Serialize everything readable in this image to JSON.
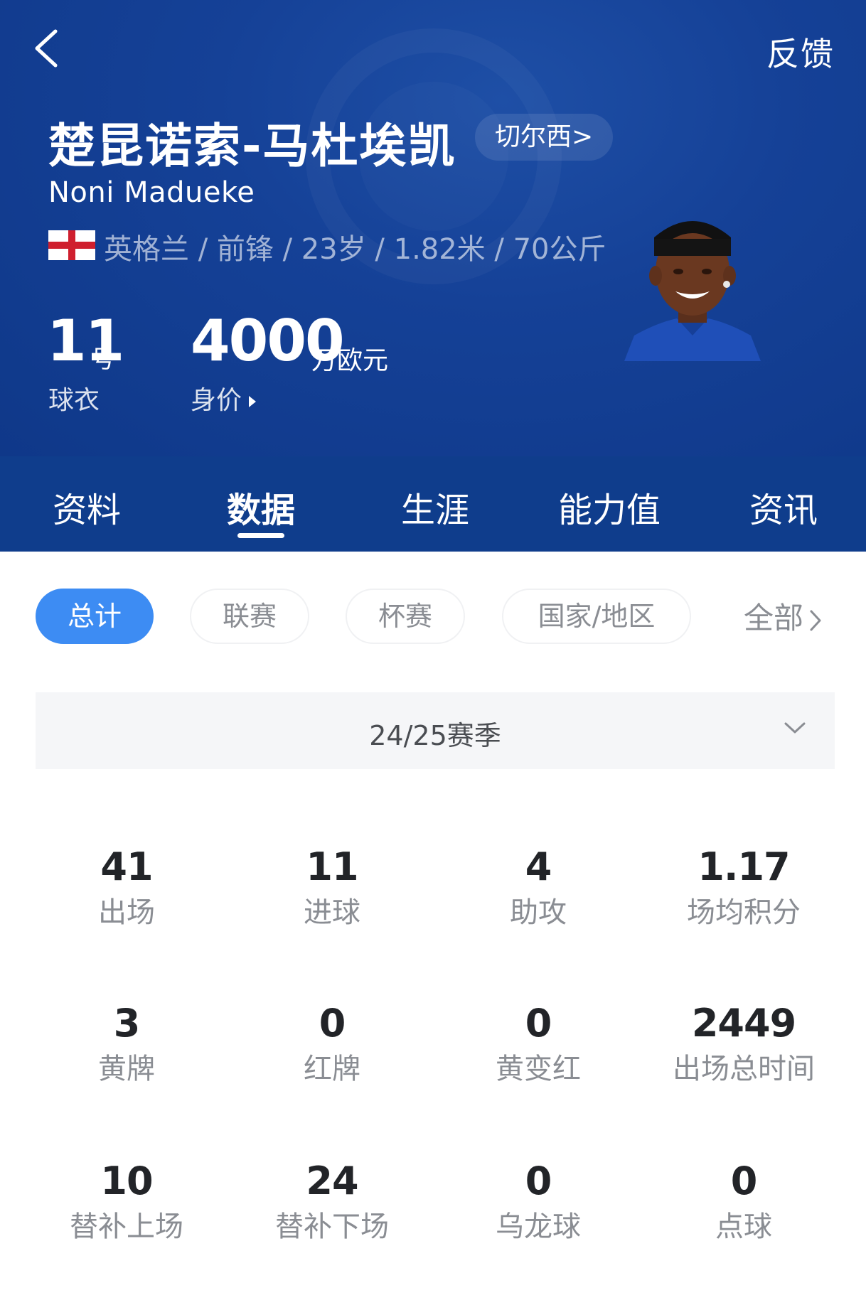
{
  "header": {
    "feedback_label": "反馈",
    "player_name_cn": "楚昆诺索-马杜埃凯",
    "club_label": "切尔西>",
    "player_name_en": "Noni Madueke",
    "profile_line": "英格兰 / 前锋 / 23岁 / 1.82米 / 70公斤",
    "jersey_number": "11",
    "jersey_unit": "号",
    "jersey_label": "球衣",
    "market_value": "4000",
    "market_value_unit": "万欧元",
    "market_value_label": "身价"
  },
  "tabs": [
    {
      "label": "资料"
    },
    {
      "label": "数据"
    },
    {
      "label": "生涯"
    },
    {
      "label": "能力值"
    },
    {
      "label": "资讯"
    }
  ],
  "active_tab": "数据",
  "filters": {
    "chips": [
      {
        "label": "总计"
      },
      {
        "label": "联赛"
      },
      {
        "label": "杯赛"
      },
      {
        "label": "国家/地区"
      }
    ],
    "active_chip": "总计",
    "all_label": "全部"
  },
  "season": {
    "selected": "24/25赛季"
  },
  "stats": [
    {
      "value": "41",
      "label": "出场"
    },
    {
      "value": "11",
      "label": "进球"
    },
    {
      "value": "4",
      "label": "助攻"
    },
    {
      "value": "1.17",
      "label": "场均积分"
    },
    {
      "value": "3",
      "label": "黄牌"
    },
    {
      "value": "0",
      "label": "红牌"
    },
    {
      "value": "0",
      "label": "黄变红"
    },
    {
      "value": "2449",
      "label": "出场总时间"
    },
    {
      "value": "10",
      "label": "替补上场"
    },
    {
      "value": "24",
      "label": "替补下场"
    },
    {
      "value": "0",
      "label": "乌龙球"
    },
    {
      "value": "0",
      "label": "点球"
    }
  ],
  "colors": {
    "header_bg": "#154197",
    "tab_bg": "#0f3d8c",
    "accent": "#3d8cf3",
    "text_dark": "#222428",
    "text_muted": "#8a8d93"
  },
  "icons": [
    "back-arrow-icon",
    "england-flag-icon",
    "player-avatar",
    "triangle-right-icon",
    "chevron-right-icon",
    "chevron-down-icon"
  ]
}
